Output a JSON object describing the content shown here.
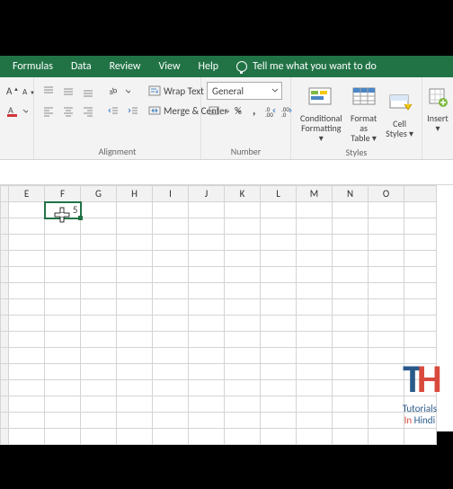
{
  "tabs": {
    "formulas": "Formulas",
    "data": "Data",
    "review": "Review",
    "view": "View",
    "help": "Help",
    "tell": "Tell me what you want to do"
  },
  "ribbon": {
    "wrap_text": "Wrap Text",
    "merge_center": "Merge & Center",
    "alignment_label": "Alignment",
    "number_format": "General",
    "number_label": "Number",
    "cond_fmt_l1": "Conditional",
    "cond_fmt_l2": "Formatting",
    "fmt_table_l1": "Format as",
    "fmt_table_l2": "Table",
    "cell_styles_l1": "Cell",
    "cell_styles_l2": "Styles",
    "styles_label": "Styles",
    "insert": "Insert"
  },
  "grid": {
    "columns": [
      "E",
      "F",
      "G",
      "H",
      "I",
      "J",
      "K",
      "L",
      "M",
      "N",
      "O"
    ],
    "selected_cell_value": "5"
  },
  "watermark": {
    "t": "T",
    "h": "H",
    "line1": "Tutorials",
    "in": "In",
    "line2_rest": " Hindi"
  }
}
